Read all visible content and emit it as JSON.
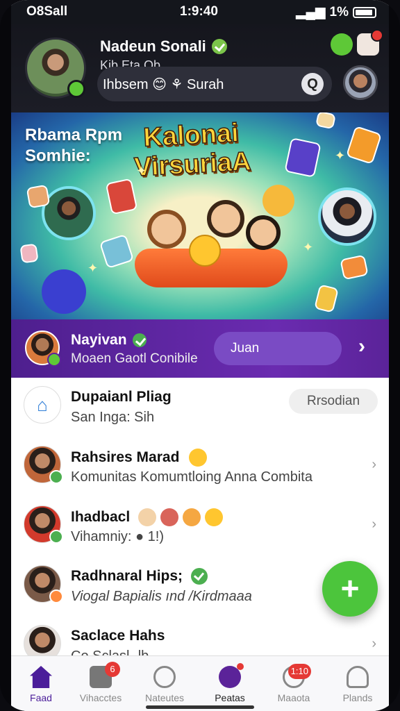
{
  "status": {
    "carrier": "O8Sall",
    "time": "1:9:40",
    "battery": "1%"
  },
  "header": {
    "name": "Nadeun Sonali",
    "subtitle": "Kib Eta Ob",
    "search_text": "Ihbsem 😊 ⚘ Surah",
    "search_icon": "search-icon"
  },
  "banner": {
    "left_title": "Rbama Rpm\nSomhie:",
    "headline": "Kalonai\nVirsuriaA"
  },
  "promo": {
    "title": "Nayivan",
    "subtitle": "Moaen Gaotl Conibile",
    "button": "Juan"
  },
  "list": [
    {
      "title": "Dupaianl Pliag",
      "subtitle": "San Inga: Sih",
      "pill": "Rrsodian"
    },
    {
      "title": "Rahsires Marad",
      "subtitle": "Komunitas Komumtloing Anna Combita"
    },
    {
      "title": "Ihadbacl",
      "subtitle": "Vihamniy: ● 1!)"
    },
    {
      "title": "Radhnaral Hips;",
      "subtitle": "Viogal Bapialis ınd /Kirdmaaa"
    },
    {
      "title": "Saclace Hahs",
      "subtitle": "Co Sclasl ·lb"
    }
  ],
  "tabs": [
    {
      "label": "Faad",
      "icon": "home-icon",
      "badge": ""
    },
    {
      "label": "Vihacctes",
      "icon": "gallery-icon",
      "badge": "6"
    },
    {
      "label": "Nateutes",
      "icon": "chat-icon",
      "badge": ""
    },
    {
      "label": "Peatas",
      "icon": "globe-icon",
      "badge": ""
    },
    {
      "label": "Maaota",
      "icon": "messages-icon",
      "badge": "1:10"
    },
    {
      "label": "Plands",
      "icon": "profile-icon",
      "badge": ""
    }
  ],
  "colors": {
    "accent_purple": "#5b2399",
    "green": "#4cc53c",
    "badge_red": "#e53935"
  }
}
